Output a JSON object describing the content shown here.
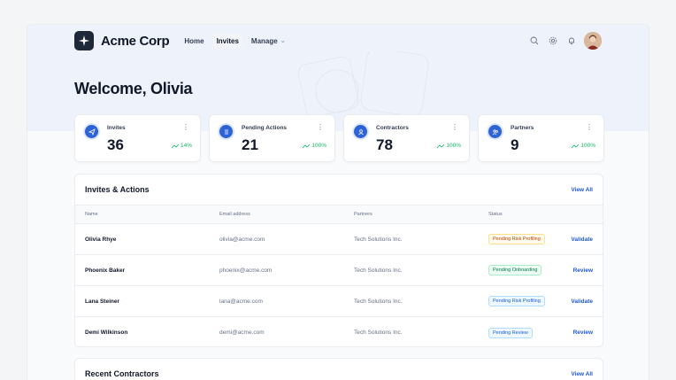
{
  "brand": "Acme Corp",
  "nav": {
    "items": [
      {
        "label": "Home"
      },
      {
        "label": "Invites"
      },
      {
        "label": "Manage"
      }
    ],
    "icons": [
      "search-icon",
      "gear-icon",
      "bell-icon"
    ]
  },
  "welcome": "Welcome, Olivia",
  "stats": [
    {
      "label": "Invites",
      "value": "36",
      "trend": "14%",
      "icon": "send-icon"
    },
    {
      "label": "Pending Actions",
      "value": "21",
      "trend": "100%",
      "icon": "list-icon"
    },
    {
      "label": "Contractors",
      "value": "78",
      "trend": "100%",
      "icon": "user-icon"
    },
    {
      "label": "Partners",
      "value": "9",
      "trend": "100%",
      "icon": "users-icon"
    }
  ],
  "invites_table": {
    "title": "Invites & Actions",
    "view_all": "View All",
    "columns": [
      "Name",
      "Email address",
      "Partners",
      "Status"
    ],
    "rows": [
      {
        "name": "Olivia Rhye",
        "email": "olivia@acme.com",
        "partner": "Tech Solutions Inc.",
        "status": "Pending Risk Profiling",
        "action": "Validate"
      },
      {
        "name": "Phoenix Baker",
        "email": "phoenix@acme.com",
        "partner": "Tech Solutions Inc.",
        "status": "Pending Onboarding",
        "action": "Review"
      },
      {
        "name": "Lana Steiner",
        "email": "lana@acme.com",
        "partner": "Tech Solutions Inc.",
        "status": "Pending Risk Profiling",
        "action": "Validate"
      },
      {
        "name": "Demi Wilkinson",
        "email": "demi@acme.com",
        "partner": "Tech Solutions Inc.",
        "status": "Pending Review",
        "action": "Review"
      }
    ]
  },
  "contractors": {
    "title": "Recent Contractors",
    "view_all": "View All"
  },
  "colors": {
    "accent": "#1d58d8",
    "trend": "#12b76a",
    "icon_bg": "#2e63d6"
  }
}
